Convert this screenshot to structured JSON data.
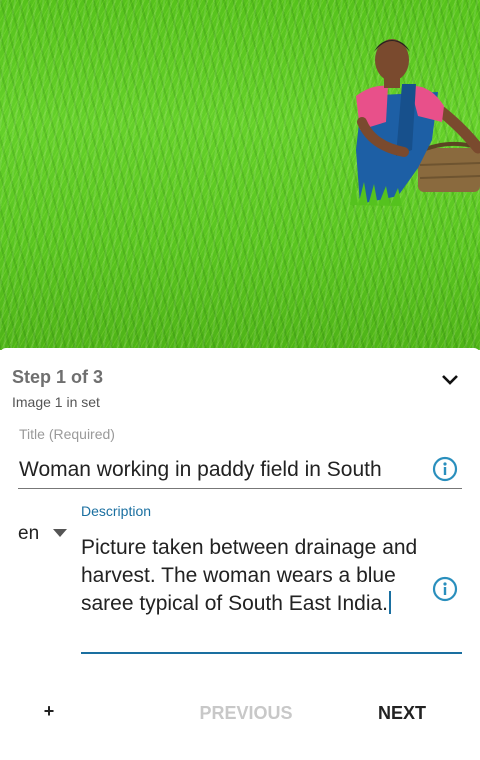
{
  "photo": {
    "subject": "woman-in-paddy-field",
    "colors": {
      "grass": "#5cc923",
      "saree": "#1d5fa5",
      "blouse": "#e8508a"
    }
  },
  "card": {
    "step_title": "Step 1 of 3",
    "step_subtitle": "Image 1 in set",
    "collapse_icon": "chevron-down-icon",
    "title_field": {
      "label": "Title (Required)",
      "value": "Woman working in paddy field in South",
      "info_icon": "info-icon"
    },
    "language": {
      "selected": "en",
      "caret_icon": "caret-down-icon"
    },
    "description_field": {
      "label": "Description",
      "value": "Picture taken between drainage and harvest. The woman wears a blue saree typical of South East India.",
      "info_icon": "info-icon"
    },
    "actions": {
      "add_label": "+",
      "previous_label": "PREVIOUS",
      "next_label": "NEXT"
    }
  },
  "colors": {
    "accent": "#1a6fa0",
    "info_icon": "#2a8fbd",
    "disabled": "#c8c8c8"
  }
}
